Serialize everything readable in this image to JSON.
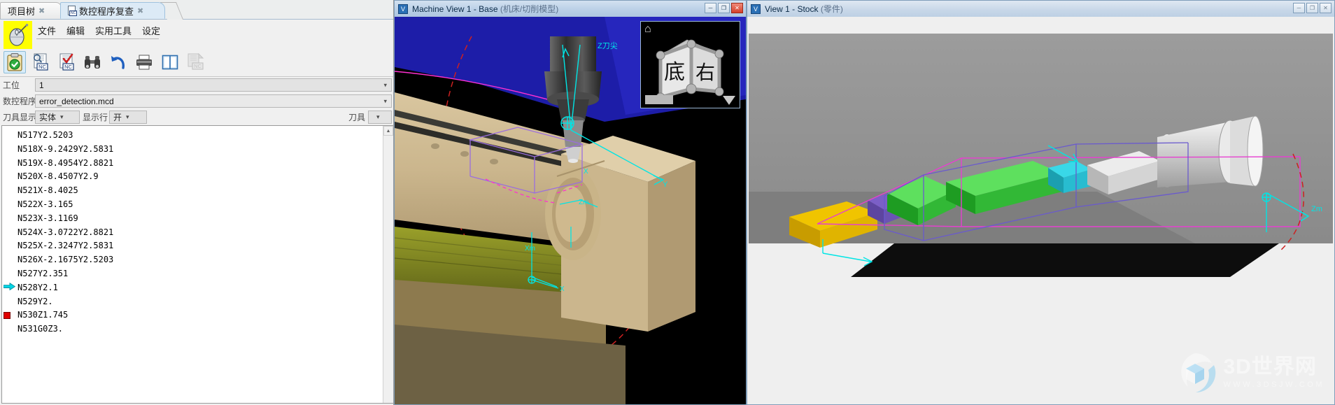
{
  "left_panel": {
    "tabs": [
      {
        "label": "项目树",
        "close": "✖",
        "active": false
      },
      {
        "label": "数控程序复查",
        "close": "✖",
        "active": true
      }
    ],
    "menu": [
      "文件",
      "编辑",
      "实用工具",
      "设定"
    ],
    "toolbar_buttons": [
      {
        "name": "verify-clipboard",
        "label": "校验"
      },
      {
        "name": "preview-nc",
        "label": "预览NC"
      },
      {
        "name": "check-nc",
        "label": "检查NC"
      },
      {
        "name": "find",
        "label": "查找"
      },
      {
        "name": "undo",
        "label": "撤销"
      },
      {
        "name": "print",
        "label": "打印"
      },
      {
        "name": "split-view",
        "label": "分栏"
      },
      {
        "name": "copy-nc",
        "label": "复制NC"
      }
    ],
    "fields": {
      "station_label": "工位",
      "station_value": "1",
      "program_label": "数控程序",
      "program_value": "error_detection.mcd",
      "tool_display_label": "刀具显示",
      "tool_display_value": "实体",
      "show_line_label": "显示行",
      "show_line_value": "开",
      "tool_label": "刀具",
      "tool_value": ""
    },
    "code_lines": [
      {
        "text": "N517Y2.5203",
        "marker": "none"
      },
      {
        "text": "N518X-9.2429Y2.5831",
        "marker": "none"
      },
      {
        "text": "N519X-8.4954Y2.8821",
        "marker": "none"
      },
      {
        "text": "N520X-8.4507Y2.9",
        "marker": "none"
      },
      {
        "text": "N521X-8.4025",
        "marker": "none"
      },
      {
        "text": "N522X-3.165",
        "marker": "none"
      },
      {
        "text": "N523X-3.1169",
        "marker": "none"
      },
      {
        "text": "N524X-3.0722Y2.8821",
        "marker": "none"
      },
      {
        "text": "N525X-2.3247Y2.5831",
        "marker": "none"
      },
      {
        "text": "N526X-2.1675Y2.5203",
        "marker": "none"
      },
      {
        "text": "N527Y2.351",
        "marker": "none"
      },
      {
        "text": "N528Y2.1",
        "marker": "current"
      },
      {
        "text": "N529Y2.",
        "marker": "none"
      },
      {
        "text": "N530Z1.745",
        "marker": "error"
      },
      {
        "text": "N531G0Z3.",
        "marker": "none"
      }
    ]
  },
  "machine_view": {
    "title": "Machine View 1 - Base",
    "subtitle": "(机床/切削模型)",
    "buttons": {
      "minimize": "─",
      "maximize": "❐",
      "close": "✕"
    },
    "annotations": {
      "tool_tip": "Z刀尖",
      "axis_x": "X",
      "axis_y": "Y",
      "zm": "Zm",
      "xm": "Xm",
      "ym": "Ym"
    },
    "viewcube": {
      "face_front": "底",
      "face_right": "右",
      "home_icon": "home-icon"
    }
  },
  "stock_view": {
    "title": "View 1 - Stock",
    "subtitle": "(零件)",
    "buttons": {
      "minimize": "─",
      "maximize": "❐",
      "close": "✕"
    },
    "annotations": {
      "zm": "Zm"
    }
  },
  "watermark": {
    "main": "3D世界网",
    "sub": "WWW.3DSJW.COM"
  },
  "colors": {
    "accent": "#2a6fb5",
    "tab_active": "#dceaf6",
    "machine_blue": "#1d1da8",
    "cyan": "#00e5e5",
    "magenta": "#ff30d0",
    "error_red": "#e00000",
    "stock_bg": "#8f8f8f",
    "tool_green": "#17a81a"
  }
}
